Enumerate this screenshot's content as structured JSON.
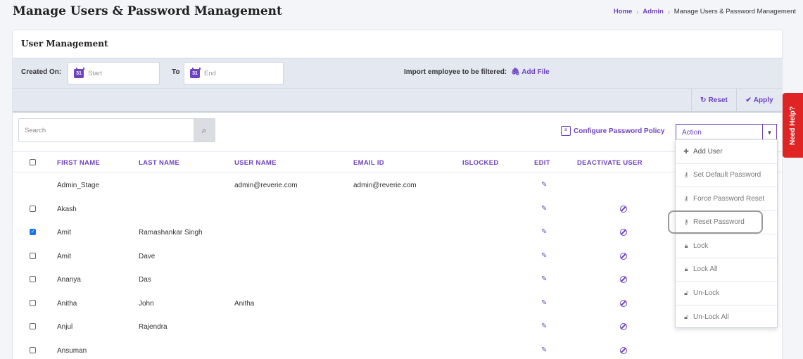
{
  "page": {
    "title": "Manage Users & Password Management"
  },
  "breadcrumb": {
    "home": "Home",
    "admin": "Admin",
    "current": "Manage Users & Password Management"
  },
  "card": {
    "title": "User Management"
  },
  "filters": {
    "created_on_label": "Created On:",
    "start_placeholder": "Start",
    "to_label": "To",
    "end_placeholder": "End",
    "import_label": "Import employee to be filtered:",
    "add_file": "Add File",
    "calendar_day": "31"
  },
  "actions": {
    "reset": "Reset",
    "apply": "Apply"
  },
  "search": {
    "placeholder": "Search"
  },
  "config": {
    "label": "Configure Password Policy"
  },
  "action_select": {
    "value": "Action"
  },
  "dropdown": {
    "items": [
      {
        "label": "Add User",
        "icon": "plus-icon"
      },
      {
        "label": "Set Default Password",
        "icon": "key-icon"
      },
      {
        "label": "Force Password Reset",
        "icon": "key-icon"
      },
      {
        "label": "Reset Password",
        "icon": "key-icon"
      },
      {
        "label": "Lock",
        "icon": "lock-icon"
      },
      {
        "label": "Lock All",
        "icon": "lock-icon"
      },
      {
        "label": "Un-Lock",
        "icon": "unlock-icon"
      },
      {
        "label": "Un-Lock All",
        "icon": "unlock-icon"
      }
    ]
  },
  "table": {
    "headers": [
      "FIRST NAME",
      "LAST NAME",
      "USER NAME",
      "EMAIL ID",
      "ISLOCKED",
      "EDIT",
      "DEACTIVATE USER"
    ],
    "rows": [
      {
        "first": "Admin_Stage",
        "last": "",
        "user": "admin@reverie.com",
        "email": "admin@reverie.com",
        "checkbox": false,
        "checked": false,
        "deactivate": false
      },
      {
        "first": "Akash",
        "last": "",
        "user": "",
        "email": "",
        "checkbox": true,
        "checked": false,
        "deactivate": true
      },
      {
        "first": "Amit",
        "last": "Ramashankar Singh",
        "user": "",
        "email": "",
        "checkbox": true,
        "checked": true,
        "deactivate": true
      },
      {
        "first": "Amit",
        "last": "Dave",
        "user": "",
        "email": "",
        "checkbox": true,
        "checked": false,
        "deactivate": true
      },
      {
        "first": "Ananya",
        "last": "Das",
        "user": "",
        "email": "",
        "checkbox": true,
        "checked": false,
        "deactivate": true
      },
      {
        "first": "Anitha",
        "last": "John",
        "user": "Anitha",
        "email": "",
        "checkbox": true,
        "checked": false,
        "deactivate": true
      },
      {
        "first": "Anjul",
        "last": "Rajendra",
        "user": "",
        "email": "",
        "checkbox": true,
        "checked": false,
        "deactivate": true
      },
      {
        "first": "Ansuman",
        "last": "",
        "user": "",
        "email": "",
        "checkbox": true,
        "checked": false,
        "deactivate": true
      }
    ]
  },
  "help": {
    "label": "Need Help?"
  },
  "colors": {
    "accent": "#6f42c1",
    "help": "#e02424",
    "filter_bg": "#e3e8f1"
  }
}
